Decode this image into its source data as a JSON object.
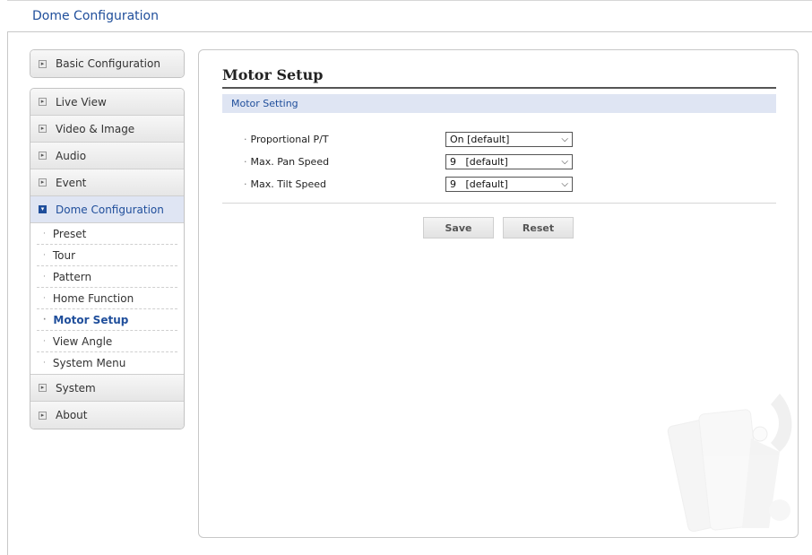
{
  "header": {
    "title": "Dome Configuration"
  },
  "sidebar": {
    "basic": "Basic Configuration",
    "items": [
      {
        "label": "Live View"
      },
      {
        "label": "Video & Image"
      },
      {
        "label": "Audio"
      },
      {
        "label": "Event"
      },
      {
        "label": "Dome Configuration"
      }
    ],
    "sub_items": [
      {
        "label": "Preset"
      },
      {
        "label": "Tour"
      },
      {
        "label": "Pattern"
      },
      {
        "label": "Home Function"
      },
      {
        "label": "Motor Setup"
      },
      {
        "label": "View Angle"
      },
      {
        "label": "System Menu"
      }
    ],
    "bottom_items": [
      {
        "label": "System"
      },
      {
        "label": "About"
      }
    ]
  },
  "main": {
    "page_title": "Motor Setup",
    "section_title": "Motor Setting",
    "fields": [
      {
        "label": "Proportional P/T",
        "value": "On [default]"
      },
      {
        "label": "Max. Pan Speed",
        "value": "9   [default]"
      },
      {
        "label": "Max. Tilt Speed",
        "value": "9   [default]"
      }
    ],
    "save_label": "Save",
    "reset_label": "Reset"
  },
  "colors": {
    "accent": "#1f4e9b",
    "section_bg": "#dfe5f3"
  },
  "icons": {
    "arrow": "expand-arrow-icon",
    "bullet": "bullet-dot-icon",
    "dropdown": "chevron-down-icon",
    "decoration": "wrench-watermark-icon"
  }
}
